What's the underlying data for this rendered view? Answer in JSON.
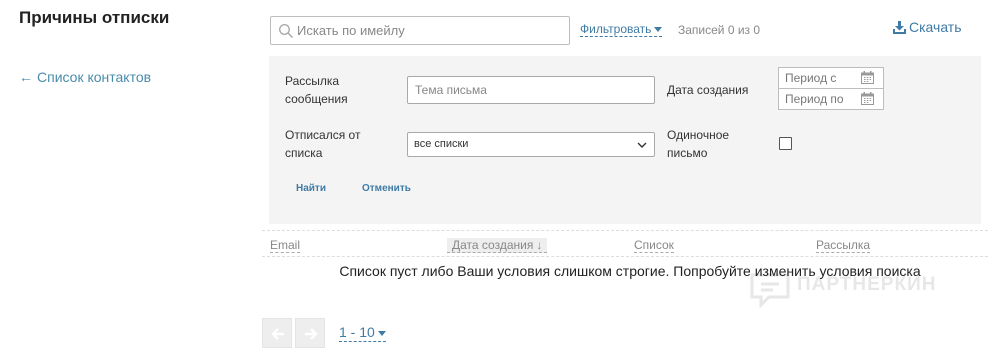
{
  "page": {
    "title": "Причины отписки",
    "back_link": "Список контактов"
  },
  "toolbar": {
    "search_placeholder": "Искать по имейлу",
    "filter_label": "Фильтровать",
    "records_count": "Записей 0 из 0",
    "download_label": "Скачать"
  },
  "filters": {
    "mailing_label": "Рассылка сообщения",
    "mailing_placeholder": "Тема письма",
    "created_label": "Дата создания",
    "date_from_placeholder": "Период с",
    "date_to_placeholder": "Период по",
    "unsubscribed_label": "Отписался от списка",
    "list_selected": "все списки",
    "single_letter_label": "Одиночное письмо",
    "single_letter_checked": false,
    "find_button": "Найти",
    "cancel_button": "Отменить"
  },
  "table": {
    "columns": [
      "Email",
      "Дата создания",
      "Список",
      "Рассылка"
    ],
    "sorted_column": "Дата создания",
    "sort_direction": "down",
    "empty_message": "Список пуст либо Ваши условия слишком строгие. Попробуйте изменить условия поиска",
    "rows": []
  },
  "pagination": {
    "page_size": "1 - 10"
  },
  "watermark": {
    "text": "ПАРТНЕРКИН"
  },
  "colors": {
    "link": "#3f7ba5",
    "panel_background": "#f4f4f4",
    "title": "#222222"
  }
}
